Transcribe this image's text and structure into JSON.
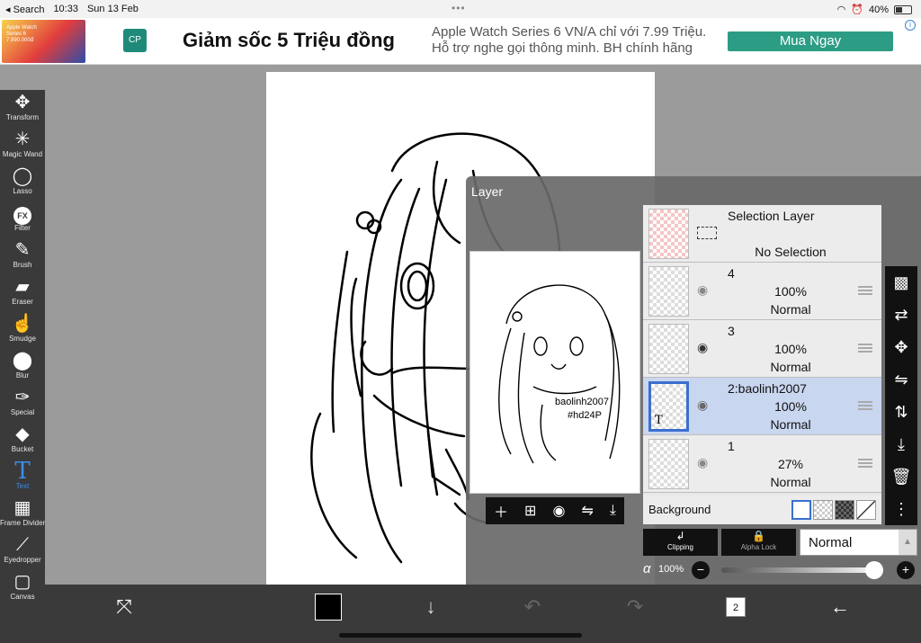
{
  "status": {
    "back_app": "Search",
    "time": "10:33",
    "date": "Sun 13 Feb",
    "dots": "•••",
    "battery": "40%"
  },
  "ad": {
    "thumb_text": "Apple Watch Series 6 7.990.000đ",
    "logo_text": "CP",
    "headline": "Giảm sốc 5 Triệu đồng",
    "line1": "Apple Watch Series 6 VN/A chỉ với 7.99 Triệu.",
    "line2": "Hỗ trợ nghe gọi thông minh. BH chính hãng",
    "cta": "Mua Ngay",
    "info": "i"
  },
  "tools": [
    {
      "name": "transform",
      "label": "Transform",
      "icon": "✥"
    },
    {
      "name": "magic-wand",
      "label": "Magic Wand",
      "icon": "✳"
    },
    {
      "name": "lasso",
      "label": "Lasso",
      "icon": "◯"
    },
    {
      "name": "filter",
      "label": "Filter",
      "icon": "FX"
    },
    {
      "name": "brush",
      "label": "Brush",
      "icon": "✎"
    },
    {
      "name": "eraser",
      "label": "Eraser",
      "icon": "▰"
    },
    {
      "name": "smudge",
      "label": "Smudge",
      "icon": "☝"
    },
    {
      "name": "blur",
      "label": "Blur",
      "icon": "💧"
    },
    {
      "name": "special",
      "label": "Special",
      "icon": "✑"
    },
    {
      "name": "bucket",
      "label": "Bucket",
      "icon": "◆"
    },
    {
      "name": "text",
      "label": "Text",
      "icon": "T"
    },
    {
      "name": "frame-divider",
      "label": "Frame Divider",
      "icon": "▦"
    },
    {
      "name": "eyedropper",
      "label": "Eyedropper",
      "icon": "⟋"
    },
    {
      "name": "canvas",
      "label": "Canvas",
      "icon": "▢"
    }
  ],
  "active_tool": "Text",
  "layer_panel": {
    "title": "Layer",
    "preview_text_1": "baolinh2007",
    "preview_text_2": "#hd24P",
    "selection_layer": {
      "name": "Selection Layer",
      "status": "No Selection"
    },
    "layers": [
      {
        "name": "4",
        "opacity": "100%",
        "blend": "Normal"
      },
      {
        "name": "3",
        "opacity": "100%",
        "blend": "Normal"
      },
      {
        "name": "2:baolinh2007",
        "opacity": "100%",
        "blend": "Normal",
        "selected": true
      },
      {
        "name": "1",
        "opacity": "27%",
        "blend": "Normal"
      }
    ],
    "background_label": "Background",
    "clipping_label": "Clipping",
    "alpha_lock_label": "Alpha Lock",
    "blend_mode": "Normal",
    "alpha_symbol": "α",
    "alpha_value": "100%",
    "alpha_fraction": 1.0
  },
  "bottom": {
    "layer_count": "2"
  }
}
